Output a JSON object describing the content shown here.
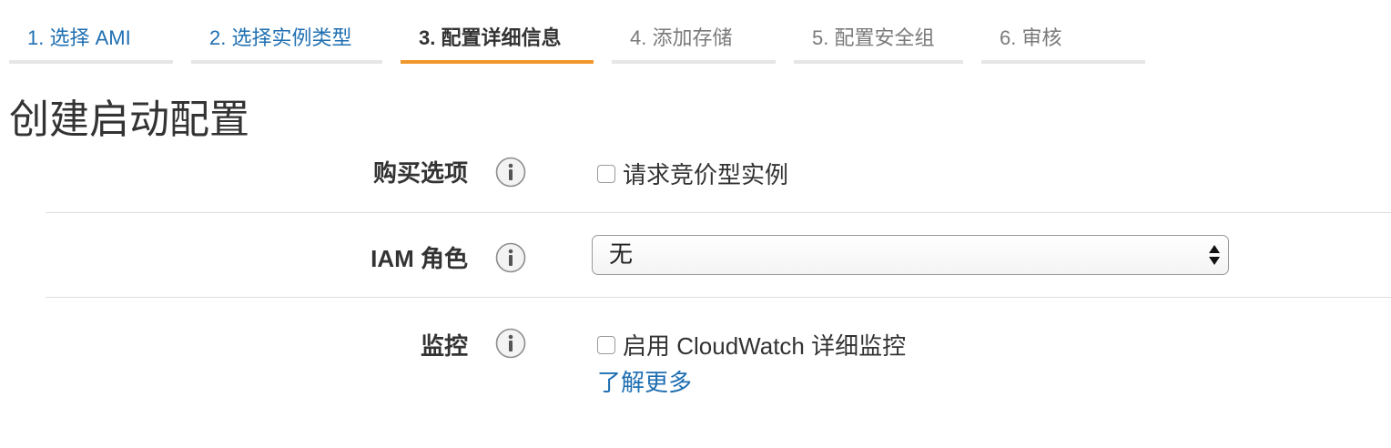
{
  "wizard": {
    "steps": [
      {
        "label": "1. 选择 AMI",
        "state": "done"
      },
      {
        "label": "2. 选择实例类型",
        "state": "done"
      },
      {
        "label": "3. 配置详细信息",
        "state": "active"
      },
      {
        "label": "4. 添加存储",
        "state": "todo"
      },
      {
        "label": "5. 配置安全组",
        "state": "todo"
      },
      {
        "label": "6. 审核",
        "state": "todo"
      }
    ]
  },
  "page": {
    "title": "创建启动配置"
  },
  "form": {
    "purchase": {
      "label": "购买选项",
      "checkbox_label": "请求竞价型实例",
      "checked": false
    },
    "iam": {
      "label": "IAM 角色",
      "selected": "无"
    },
    "monitoring": {
      "label": "监控",
      "checkbox_label": "启用 CloudWatch 详细监控",
      "checked": false,
      "link": "了解更多"
    }
  },
  "colors": {
    "link": "#1f6fb2",
    "active_tab": "#f0972c",
    "inactive_tab_border": "#e6e6e6",
    "divider": "#dddddd"
  },
  "icons": {
    "info": "info-icon",
    "select_arrows": "up-down-arrows-icon"
  }
}
